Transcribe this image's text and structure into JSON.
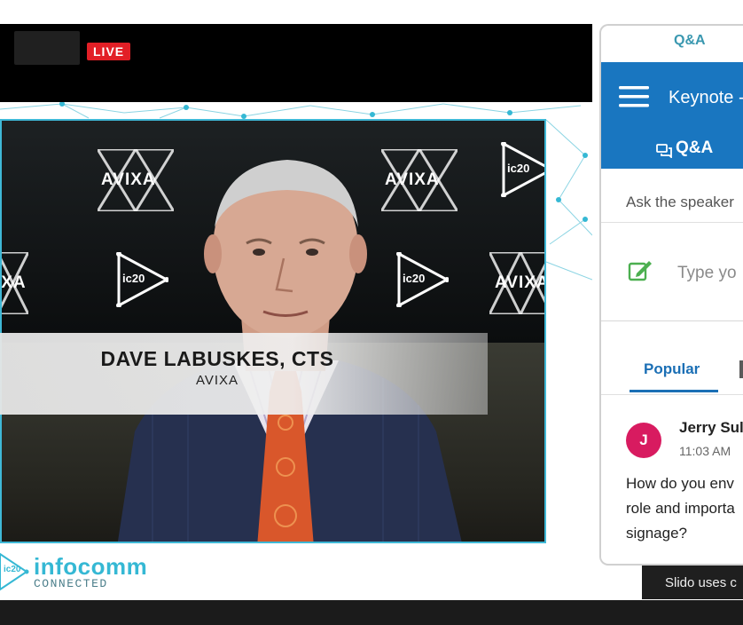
{
  "stream": {
    "live_label": "LIVE"
  },
  "video": {
    "wall_logos": {
      "avixa_text": "AVIXA",
      "ic_text": "ic20"
    },
    "lower_third": {
      "name": "DAVE LABUSKES, CTS",
      "organization": "AVIXA"
    }
  },
  "brand": {
    "logo_text": "infocomm",
    "logo_sub": "CONNECTED",
    "badge_text": "ic20",
    "accent_color": "#3fb8d6"
  },
  "slido": {
    "panel_title": "Q&A",
    "header_color": "#1976c0",
    "event_title": "Keynote -",
    "active_tab": "Q&A",
    "ask_label": "Ask the speaker",
    "input_placeholder": "Type yo",
    "tabs": [
      {
        "label": "Popular",
        "active": true
      }
    ],
    "question": {
      "avatar_initial": "J",
      "author": "Jerry Sul",
      "time": "11:03 AM",
      "lines": [
        "How do you env",
        "role and importa",
        "signage?"
      ]
    },
    "footer_text": "Slido uses c"
  }
}
